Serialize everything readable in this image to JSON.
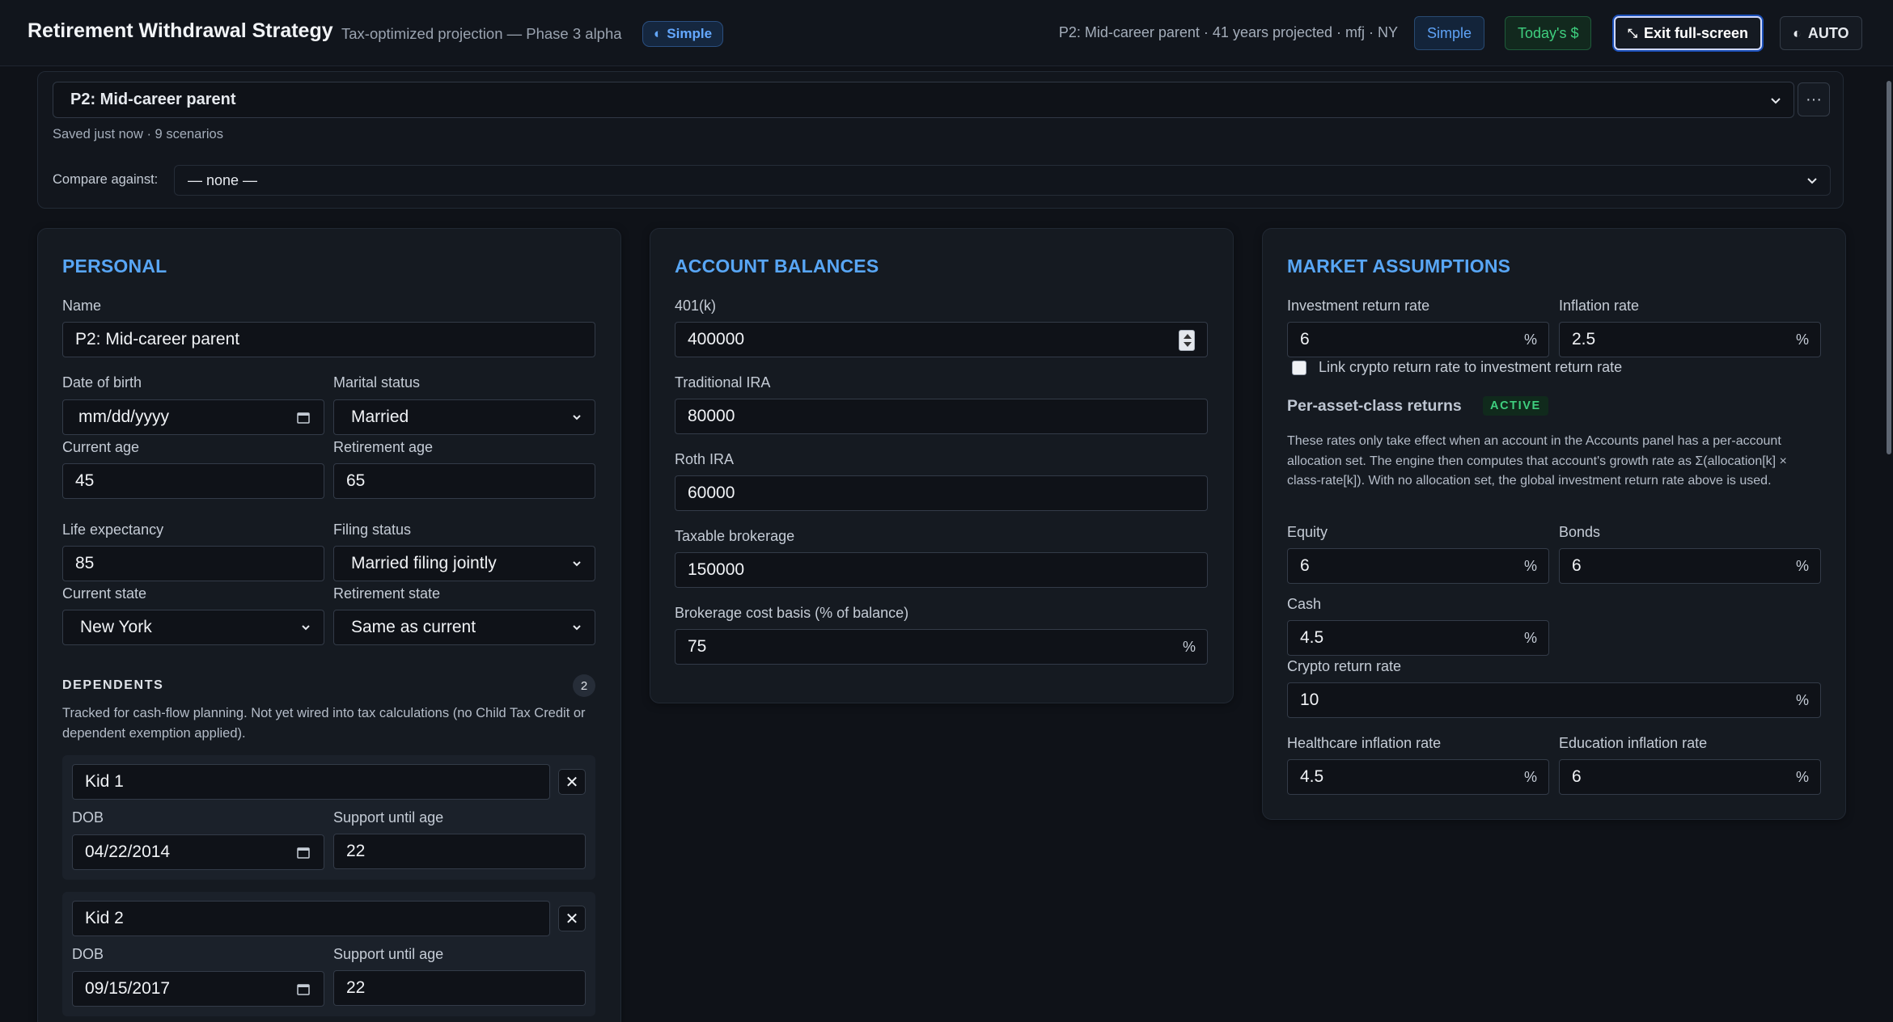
{
  "header": {
    "title": "Retirement Withdrawal Strategy",
    "subtitle": "Tax-optimized projection — Phase 3 alpha",
    "mode_badge": "Simple",
    "context": "P2: Mid-career parent · 41 years projected · mfj · NY",
    "simple_button": "Simple",
    "today_button": "Today's $",
    "exit_button": "Exit full-screen",
    "theme_button": "AUTO"
  },
  "scenario": {
    "selected": "P2: Mid-career parent",
    "saved_status": "Saved just now · 9 scenarios",
    "compare_label": "Compare against:",
    "compare_value": "— none —"
  },
  "personal": {
    "title": "PERSONAL",
    "name_label": "Name",
    "name_value": "P2: Mid-career parent",
    "dob_label": "Date of birth",
    "dob_placeholder": "mm/dd/yyyy",
    "marital_label": "Marital status",
    "marital_value": "Married",
    "current_age_label": "Current age",
    "current_age_value": "45",
    "retirement_age_label": "Retirement age",
    "retirement_age_value": "65",
    "life_exp_label": "Life expectancy",
    "life_exp_value": "85",
    "filing_label": "Filing status",
    "filing_value": "Married filing jointly",
    "current_state_label": "Current state",
    "current_state_value": "New York",
    "retirement_state_label": "Retirement state",
    "retirement_state_value": "Same as current"
  },
  "dependents": {
    "heading": "DEPENDENTS",
    "count": "2",
    "note": "Tracked for cash-flow planning. Not yet wired into tax calculations (no Child Tax Credit or dependent exemption applied).",
    "dob_label": "DOB",
    "support_label": "Support until age",
    "items": [
      {
        "name": "Kid 1",
        "dob": "04/22/2014",
        "support_until": "22"
      },
      {
        "name": "Kid 2",
        "dob": "09/15/2017",
        "support_until": "22"
      }
    ]
  },
  "accounts": {
    "title": "ACCOUNT BALANCES",
    "k401_label": "401(k)",
    "k401_value": "400000",
    "trad_ira_label": "Traditional IRA",
    "trad_ira_value": "80000",
    "roth_ira_label": "Roth IRA",
    "roth_ira_value": "60000",
    "taxable_label": "Taxable brokerage",
    "taxable_value": "150000",
    "basis_label": "Brokerage cost basis (% of balance)",
    "basis_value": "75",
    "percent": "%"
  },
  "market": {
    "title": "MARKET ASSUMPTIONS",
    "investment_label": "Investment return rate",
    "investment_value": "6",
    "inflation_label": "Inflation rate",
    "inflation_value": "2.5",
    "link_crypto_label": "Link crypto return rate to investment return rate",
    "per_asset_heading": "Per-asset-class returns",
    "active_badge": "ACTIVE",
    "per_asset_note": "These rates only take effect when an account in the Accounts panel has a per-account allocation set. The engine then computes that account's growth rate as Σ(allocation[k] × class-rate[k]). With no allocation set, the global investment return rate above is used.",
    "equity_label": "Equity",
    "equity_value": "6",
    "bonds_label": "Bonds",
    "bonds_value": "6",
    "cash_label": "Cash",
    "cash_value": "4.5",
    "crypto_label": "Crypto return rate",
    "crypto_value": "10",
    "healthcare_label": "Healthcare inflation rate",
    "healthcare_value": "4.5",
    "education_label": "Education inflation rate",
    "education_value": "6",
    "percent": "%"
  }
}
